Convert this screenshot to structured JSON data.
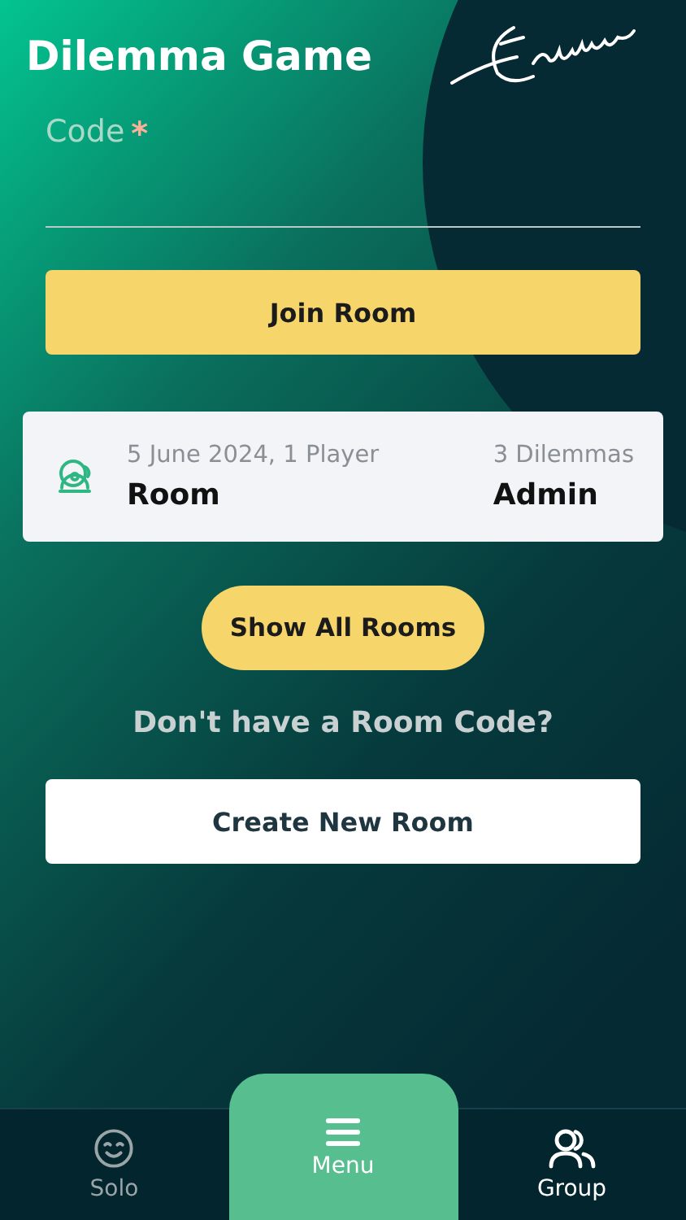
{
  "header": {
    "title": "Dilemma Game"
  },
  "code_field": {
    "label": "Code",
    "required_mark": "*"
  },
  "join_button": "Join Room",
  "room_card": {
    "meta": "5 June 2024, 1 Player",
    "dilemmas": "3 Dilemmas",
    "name": "Room",
    "role": "Admin"
  },
  "show_all_button": "Show All Rooms",
  "prompt": "Don't have a Room Code?",
  "create_button": "Create New Room",
  "nav": [
    {
      "label": "Solo",
      "kind": "solo",
      "selected": false
    },
    {
      "label": "Menu",
      "kind": "menu",
      "selected": false
    },
    {
      "label": "Group",
      "kind": "group",
      "selected": true
    }
  ]
}
